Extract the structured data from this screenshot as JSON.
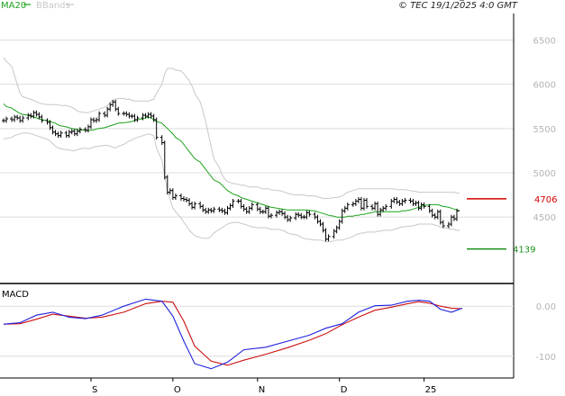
{
  "header": {
    "ma_legend": "MA20",
    "bbands_legend": "BBands",
    "copyright": "© TEC 19/1/2025 4:0 GMT"
  },
  "chart_data": [
    {
      "type": "line",
      "panel": "price",
      "ylim": [
        3800,
        6800
      ],
      "yticks": [
        4500,
        5000,
        5500,
        6000,
        6500
      ],
      "ytick_labels": [
        "4500",
        "5000",
        "5500",
        "6000",
        "6500"
      ],
      "x_axis_labels": [
        {
          "label": "S",
          "day": 32
        },
        {
          "label": "O",
          "day": 62
        },
        {
          "label": "N",
          "day": 93
        },
        {
          "label": "D",
          "day": 123
        },
        {
          "label": "25",
          "day": 154
        }
      ],
      "price_x": [
        0,
        1,
        3,
        4,
        5,
        6,
        7,
        9,
        10,
        11,
        12,
        13,
        14,
        16,
        17,
        18,
        19,
        20,
        21,
        23,
        24,
        25,
        26,
        27,
        28,
        30,
        31,
        32,
        33,
        34,
        35,
        37,
        38,
        39,
        40,
        41,
        42,
        44,
        45,
        46,
        47,
        48,
        49,
        51,
        52,
        53,
        54,
        55,
        56,
        58,
        59,
        60,
        61,
        62,
        63,
        65,
        66,
        67,
        68,
        69,
        70,
        72,
        73,
        74,
        75,
        76,
        77,
        79,
        80,
        81,
        82,
        83,
        84,
        86,
        87,
        88,
        89,
        90,
        91,
        93,
        94,
        95,
        96,
        97,
        98,
        100,
        101,
        102,
        103,
        104,
        105,
        107,
        108,
        109,
        110,
        111,
        112,
        114,
        115,
        116,
        117,
        118,
        119,
        121,
        122,
        123,
        124,
        125,
        126,
        128,
        129,
        130,
        131,
        132,
        133,
        135,
        136,
        137,
        138,
        139,
        140,
        142,
        143,
        144,
        145,
        146,
        147,
        149,
        150,
        151,
        152,
        153,
        154,
        156,
        157,
        158,
        159,
        160,
        161,
        163,
        164,
        165,
        166,
        167,
        168
      ],
      "price": [
        5590,
        5610,
        5600,
        5630,
        5620,
        5590,
        5620,
        5650,
        5640,
        5680,
        5660,
        5630,
        5590,
        5570,
        5510,
        5460,
        5440,
        5420,
        5450,
        5420,
        5460,
        5470,
        5440,
        5470,
        5490,
        5480,
        5520,
        5600,
        5590,
        5600,
        5670,
        5650,
        5720,
        5770,
        5800,
        5720,
        5670,
        5670,
        5660,
        5640,
        5640,
        5600,
        5620,
        5650,
        5640,
        5660,
        5640,
        5600,
        5400,
        5340,
        4950,
        4780,
        4800,
        4720,
        4740,
        4710,
        4700,
        4690,
        4650,
        4610,
        4650,
        4620,
        4580,
        4560,
        4580,
        4570,
        4590,
        4580,
        4570,
        4550,
        4600,
        4630,
        4680,
        4680,
        4620,
        4590,
        4560,
        4600,
        4640,
        4590,
        4560,
        4560,
        4600,
        4510,
        4520,
        4550,
        4560,
        4540,
        4500,
        4470,
        4490,
        4530,
        4520,
        4500,
        4500,
        4550,
        4530,
        4500,
        4450,
        4420,
        4350,
        4250,
        4280,
        4340,
        4380,
        4450,
        4570,
        4600,
        4640,
        4650,
        4680,
        4700,
        4600,
        4690,
        4620,
        4600,
        4650,
        4530,
        4580,
        4600,
        4620,
        4680,
        4700,
        4670,
        4650,
        4680,
        4690,
        4680,
        4650,
        4660,
        4600,
        4640,
        4620,
        4570,
        4520,
        4500,
        4560,
        4440,
        4400,
        4420,
        4500,
        4480,
        4570
      ],
      "ma20": [
        5780,
        5750,
        5730,
        5710,
        5690,
        5670,
        5660,
        5650,
        5640,
        5630,
        5620,
        5610,
        5600,
        5590,
        5580,
        5570,
        5560,
        5540,
        5530,
        5520,
        5510,
        5500,
        5495,
        5490,
        5485,
        5480,
        5480,
        5480,
        5485,
        5495,
        5500,
        5510,
        5520,
        5530,
        5540,
        5550,
        5560,
        5565,
        5570,
        5575,
        5580,
        5590,
        5600,
        5610,
        5620,
        5630,
        5620,
        5600,
        5580,
        5560,
        5530,
        5500,
        5470,
        5440,
        5400,
        5360,
        5320,
        5280,
        5240,
        5200,
        5160,
        5120,
        5080,
        5040,
        5000,
        4960,
        4920,
        4890,
        4860,
        4830,
        4800,
        4780,
        4760,
        4740,
        4720,
        4710,
        4700,
        4690,
        4680,
        4660,
        4650,
        4640,
        4630,
        4620,
        4610,
        4600,
        4595,
        4590,
        4585,
        4580,
        4580,
        4580,
        4580,
        4580,
        4580,
        4580,
        4575,
        4570,
        4560,
        4550,
        4540,
        4530,
        4520,
        4510,
        4500,
        4500,
        4500,
        4500,
        4510,
        4510,
        4520,
        4520,
        4530,
        4530,
        4540,
        4550,
        4560,
        4560,
        4560,
        4560,
        4560,
        4560,
        4560,
        4560,
        4560,
        4570,
        4570,
        4580,
        4590,
        4600,
        4610,
        4620,
        4630,
        4640,
        4640,
        4640,
        4640,
        4630,
        4620,
        4610,
        4600,
        4590,
        4580,
        4570
      ],
      "bband_upper": [
        6300,
        6260,
        6200,
        6100,
        6000,
        5900,
        5860,
        5840,
        5830,
        5820,
        5800,
        5790,
        5780,
        5770,
        5770,
        5770,
        5770,
        5770,
        5760,
        5760,
        5750,
        5740,
        5720,
        5700,
        5690,
        5680,
        5680,
        5690,
        5700,
        5710,
        5720,
        5740,
        5760,
        5790,
        5820,
        5830,
        5840,
        5840,
        5830,
        5830,
        5820,
        5810,
        5810,
        5810,
        5810,
        5810,
        5820,
        5830,
        5900,
        6000,
        6120,
        6180,
        6180,
        6180,
        6160,
        6150,
        6120,
        6080,
        6040,
        5980,
        5900,
        5800,
        5700,
        5580,
        5440,
        5300,
        5160,
        5060,
        4980,
        4930,
        4900,
        4890,
        4880,
        4870,
        4860,
        4860,
        4850,
        4840,
        4840,
        4840,
        4830,
        4820,
        4820,
        4820,
        4810,
        4800,
        4800,
        4790,
        4780,
        4770,
        4760,
        4750,
        4750,
        4750,
        4750,
        4740,
        4740,
        4740,
        4730,
        4720,
        4710,
        4710,
        4710,
        4720,
        4720,
        4730,
        4740,
        4760,
        4780,
        4800,
        4810,
        4820,
        4820,
        4820,
        4820,
        4820,
        4820,
        4820,
        4820,
        4820,
        4820,
        4820,
        4820,
        4810,
        4810,
        4810,
        4810,
        4800,
        4790,
        4790,
        4780,
        4780,
        4780,
        4780,
        4780,
        4780,
        4780,
        4780,
        4780,
        4780,
        4780,
        4780,
        4770,
        4770
      ],
      "bband_lower": [
        5380,
        5390,
        5400,
        5420,
        5430,
        5440,
        5450,
        5450,
        5440,
        5430,
        5420,
        5410,
        5400,
        5380,
        5360,
        5330,
        5300,
        5280,
        5270,
        5260,
        5260,
        5250,
        5250,
        5260,
        5270,
        5280,
        5270,
        5280,
        5290,
        5300,
        5300,
        5310,
        5310,
        5300,
        5290,
        5280,
        5300,
        5320,
        5340,
        5360,
        5370,
        5390,
        5400,
        5420,
        5430,
        5440,
        5430,
        5420,
        5280,
        5140,
        4960,
        4800,
        4700,
        4600,
        4560,
        4490,
        4440,
        4400,
        4350,
        4320,
        4290,
        4270,
        4260,
        4260,
        4260,
        4280,
        4320,
        4360,
        4380,
        4400,
        4420,
        4430,
        4440,
        4440,
        4430,
        4420,
        4410,
        4400,
        4390,
        4380,
        4380,
        4380,
        4380,
        4370,
        4360,
        4360,
        4360,
        4350,
        4340,
        4320,
        4310,
        4300,
        4290,
        4270,
        4260,
        4250,
        4250,
        4240,
        4240,
        4240,
        4230,
        4220,
        4220,
        4230,
        4240,
        4240,
        4240,
        4250,
        4260,
        4280,
        4300,
        4310,
        4320,
        4320,
        4330,
        4330,
        4330,
        4340,
        4340,
        4350,
        4350,
        4350,
        4360,
        4370,
        4380,
        4390,
        4390,
        4400,
        4400,
        4410,
        4420,
        4420,
        4420,
        4420,
        4420,
        4410,
        4400,
        4390,
        4380,
        4370,
        4360,
        4360,
        4350,
        4350
      ],
      "reference_lines": [
        {
          "value": 4706,
          "label": "4706",
          "color": "#d40000"
        },
        {
          "value": 4139,
          "label": "4139",
          "color": "#1a8f1a"
        }
      ],
      "colors": {
        "price": "#000000",
        "ma20": "#1aa31a",
        "bbands": "#c8c8c8",
        "grid": "#dddddd",
        "axis_text": "#b4b4b4"
      }
    },
    {
      "type": "line",
      "panel": "macd",
      "title": "MACD",
      "ylim": [
        -140,
        40
      ],
      "yticks": [
        0,
        -100
      ],
      "ytick_labels": [
        "0.00",
        "-100"
      ],
      "series": [
        {
          "name": "MACD",
          "color": "#2020dd",
          "x": [
            0,
            6,
            12,
            18,
            24,
            30,
            36,
            44,
            52,
            58,
            62,
            66,
            70,
            76,
            82,
            88,
            96,
            104,
            112,
            118,
            124,
            130,
            136,
            142,
            148,
            152,
            156,
            160,
            164,
            168
          ],
          "values": [
            -36,
            -33,
            -18,
            -12,
            -22,
            -25,
            -18,
            0,
            14,
            10,
            -20,
            -70,
            -115,
            -125,
            -112,
            -87,
            -82,
            -70,
            -58,
            -44,
            -35,
            -12,
            1,
            2,
            10,
            12,
            10,
            -6,
            -12,
            -4
          ]
        },
        {
          "name": "Signal",
          "color": "#cc1010",
          "x": [
            0,
            6,
            12,
            18,
            24,
            30,
            36,
            44,
            52,
            58,
            62,
            66,
            70,
            76,
            82,
            88,
            96,
            104,
            112,
            118,
            124,
            130,
            136,
            142,
            148,
            152,
            156,
            160,
            164,
            168
          ],
          "values": [
            -36,
            -35,
            -26,
            -16,
            -20,
            -24,
            -22,
            -12,
            5,
            10,
            8,
            -30,
            -80,
            -110,
            -118,
            -108,
            -96,
            -83,
            -68,
            -55,
            -37,
            -22,
            -8,
            -2,
            5,
            9,
            6,
            0,
            -4,
            -5
          ]
        }
      ]
    }
  ]
}
